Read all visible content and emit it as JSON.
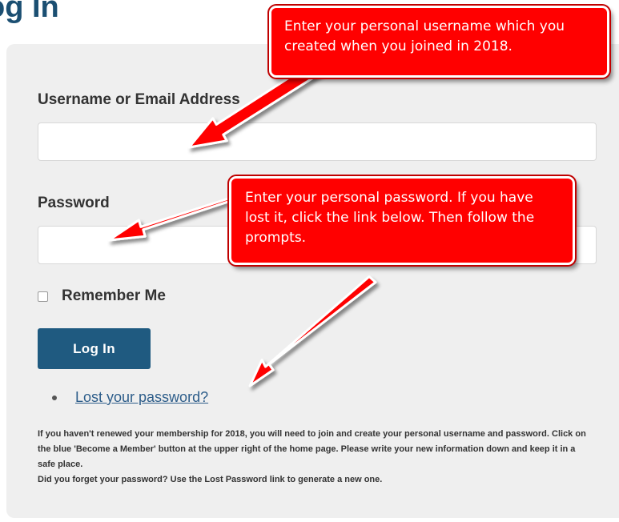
{
  "header": {
    "title": "og In"
  },
  "form": {
    "username_label": "Username or Email Address",
    "username_value": "",
    "password_label": "Password",
    "password_value": "",
    "remember_label": "Remember Me",
    "remember_checked": false,
    "login_button_label": "Log In",
    "lost_password_link": "Lost your password?"
  },
  "info": {
    "line1": "If you haven't renewed your membership for 2018, you will need to join and create your personal username and password.  Click on the blue 'Become a Member' button at the upper right of the home page.  Please write your new information down and keep it in a safe place.",
    "line2": "Did you forget your password?  Use the Lost Password link to generate a new one."
  },
  "annotations": {
    "username_callout": "Enter your personal username which you created when you joined in 2018.",
    "password_callout": "Enter your personal password.  If you have lost it, click the link below.  Then follow the prompts."
  },
  "colors": {
    "title": "#1b4f72",
    "button": "#1f5a80",
    "callout": "#ff0000",
    "panel": "#efefef"
  }
}
